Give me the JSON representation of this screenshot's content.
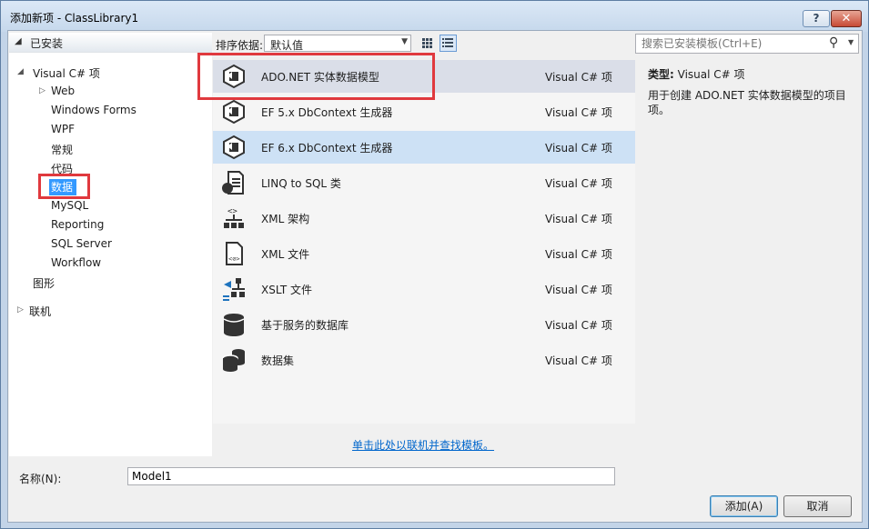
{
  "window": {
    "title": "添加新项 - ClassLibrary1",
    "help_label": "?",
    "close_label": "✕"
  },
  "tree": {
    "installed_label": "已安装",
    "root_label": "Visual C# 项",
    "items": [
      "Web",
      "Windows Forms",
      "WPF",
      "常规",
      "代码",
      "数据",
      "MySQL",
      "Reporting",
      "SQL Server",
      "Workflow"
    ],
    "graphics_label": "图形",
    "online_label": "联机"
  },
  "toolbar": {
    "sort_label": "排序依据:",
    "sort_value": "默认值",
    "search_placeholder": "搜索已安装模板(Ctrl+E)"
  },
  "templates": [
    {
      "name": "ADO.NET 实体数据模型",
      "type": "Visual C# 项",
      "icon": "entity-model-icon"
    },
    {
      "name": "EF 5.x DbContext 生成器",
      "type": "Visual C# 项",
      "icon": "ef-generator-icon"
    },
    {
      "name": "EF 6.x DbContext 生成器",
      "type": "Visual C# 项",
      "icon": "ef-generator-icon"
    },
    {
      "name": "LINQ to SQL 类",
      "type": "Visual C# 项",
      "icon": "linq-sql-icon"
    },
    {
      "name": "XML 架构",
      "type": "Visual C# 项",
      "icon": "xml-schema-icon"
    },
    {
      "name": "XML 文件",
      "type": "Visual C# 项",
      "icon": "xml-file-icon"
    },
    {
      "name": "XSLT 文件",
      "type": "Visual C# 项",
      "icon": "xslt-file-icon"
    },
    {
      "name": "基于服务的数据库",
      "type": "Visual C# 项",
      "icon": "database-icon"
    },
    {
      "name": "数据集",
      "type": "Visual C# 项",
      "icon": "dataset-icon"
    }
  ],
  "online_link": "单击此处以联机并查找模板。",
  "description": {
    "type_label": "类型:",
    "type_value": "Visual C# 项",
    "text": "用于创建 ADO.NET 实体数据模型的项目项。"
  },
  "bottom": {
    "name_label": "名称(N):",
    "name_value": "Model1",
    "add_label": "添加(A)",
    "cancel_label": "取消"
  },
  "colors": {
    "selection": "#cde1f5",
    "hover": "#dadee8",
    "highlight_box": "#e0393e",
    "tree_selection": "#3399ff",
    "link": "#0066cc"
  }
}
